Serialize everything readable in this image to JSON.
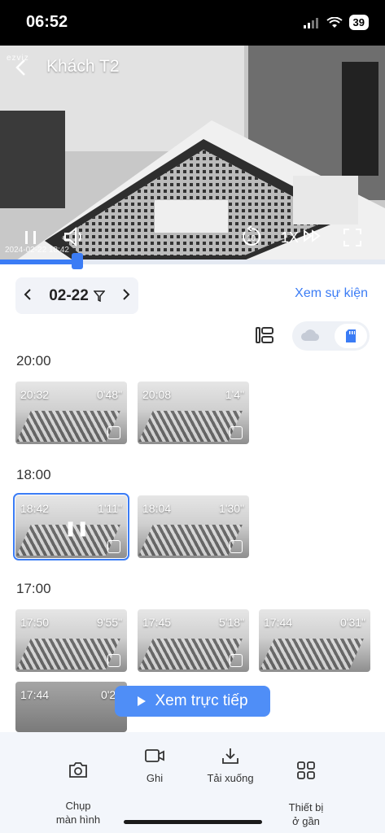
{
  "status": {
    "time": "06:52",
    "battery": "39"
  },
  "player": {
    "title": "Khách T2",
    "brand": "ezviz",
    "timestamp": "2024-02-22 18:42",
    "speed": "1X",
    "progress": 0.2
  },
  "date_nav": {
    "date": "02-22",
    "events_link": "Xem sự kiện"
  },
  "groups": [
    {
      "hour": "20:00",
      "clips": [
        {
          "time": "20:32",
          "duration": "0'48\""
        },
        {
          "time": "20:08",
          "duration": "1'4\""
        }
      ]
    },
    {
      "hour": "18:00",
      "clips": [
        {
          "time": "18:42",
          "duration": "1'11\""
        },
        {
          "time": "18:04",
          "duration": "1'30\""
        }
      ]
    },
    {
      "hour": "17:00",
      "clips": [
        {
          "time": "17:50",
          "duration": "9'55\""
        },
        {
          "time": "17:45",
          "duration": "5'18\""
        },
        {
          "time": "17:44",
          "duration": "0'31\""
        },
        {
          "time": "17:44",
          "duration": "0'27"
        }
      ]
    }
  ],
  "live_button": "Xem trực tiếp",
  "toolbar": {
    "screenshot": "Chụp\nmàn hình",
    "record": "Ghi",
    "download": "Tải xuống",
    "nearby": "Thiết bị\nở gần"
  },
  "colors": {
    "accent": "#3b7cf5",
    "live_button": "#4f8ef7"
  }
}
